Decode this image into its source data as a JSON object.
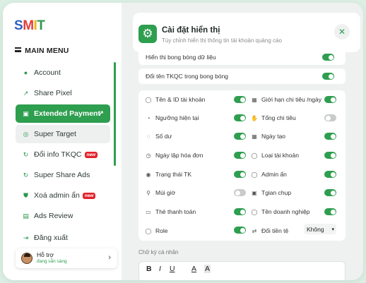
{
  "brand": {
    "logo": [
      "S",
      "M",
      "I",
      "T"
    ]
  },
  "sidebar": {
    "menu_title": "MAIN MENU",
    "items": [
      {
        "label": "Account",
        "icon": "user-icon"
      },
      {
        "label": "Share Pixel",
        "icon": "share-icon"
      },
      {
        "label": "Extended Payment",
        "icon": "wallet-icon",
        "active": true
      },
      {
        "label": "Super Target",
        "icon": "target-icon"
      },
      {
        "label": "Đổi info TKQC",
        "icon": "refresh-icon",
        "badge": "new"
      },
      {
        "label": "Super Share Ads",
        "icon": "refresh-icon"
      },
      {
        "label": "Xoá admin ẩn",
        "icon": "shield-icon",
        "badge": "new"
      },
      {
        "label": "Ads Review",
        "icon": "ad-icon"
      },
      {
        "label": "Đăng xuất",
        "icon": "logout-icon"
      }
    ],
    "support": {
      "title": "Hỗ trợ",
      "status": "đang sẵn sàng"
    }
  },
  "panel": {
    "title": "Cài đặt hiển thị",
    "subtitle": "Tùy chỉnh hiển thị thông tin tài khoản quảng cáo",
    "top_rows": [
      {
        "label": "Hiển thị bong bóng dữ liệu",
        "on": true
      },
      {
        "label": "Đổi tên TKQC trong bong bóng",
        "on": true
      }
    ],
    "left_items": [
      {
        "label": "Tên & ID tài khoản",
        "icon": "user-icon",
        "on": true
      },
      {
        "label": "Ngưỡng hiện tại",
        "icon": "gauge-icon",
        "on": true
      },
      {
        "label": "Số dư",
        "icon": "coins-icon",
        "on": true
      },
      {
        "label": "Ngày lập hóa đơn",
        "icon": "clock-icon",
        "on": true
      },
      {
        "label": "Trạng thái TK",
        "icon": "status-icon",
        "on": true
      },
      {
        "label": "Múi giờ",
        "icon": "location-icon",
        "on": false
      },
      {
        "label": "Thẻ thanh toán",
        "icon": "card-icon",
        "on": true
      },
      {
        "label": "Role",
        "icon": "user-icon",
        "on": true
      }
    ],
    "right_items": [
      {
        "label": "Giới hạn chi tiêu /ngày",
        "icon": "calendar-icon",
        "on": true
      },
      {
        "label": "Tổng chi tiêu",
        "icon": "hand-coins-icon",
        "on": false
      },
      {
        "label": "Ngày tạo",
        "icon": "calendar-icon",
        "on": true
      },
      {
        "label": "Loại tài khoản",
        "icon": "account-type-icon",
        "on": true
      },
      {
        "label": "Admin ẩn",
        "icon": "user-hidden-icon",
        "on": true
      },
      {
        "label": "Tgian chụp",
        "icon": "camera-icon",
        "on": true
      },
      {
        "label": "Tên doanh nghiệp",
        "icon": "business-icon",
        "on": true
      },
      {
        "label": "Đổi tiền tệ",
        "icon": "currency-icon",
        "select": "Không"
      }
    ],
    "signature_label": "Chữ ký cá nhân",
    "toolbar": {
      "bold": "B",
      "italic": "I",
      "underline": "U",
      "text_color": "A",
      "bg_color": "A"
    }
  },
  "colors": {
    "accent": "#2e9e4f",
    "new_badge": "#e3222b"
  }
}
